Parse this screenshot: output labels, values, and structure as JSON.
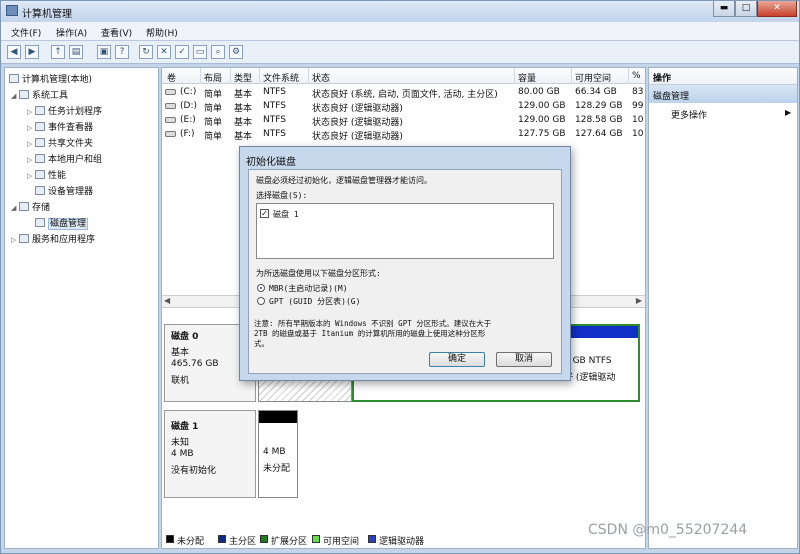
{
  "window": {
    "title": "计算机管理",
    "min": "▬",
    "max": "□",
    "close": "✕"
  },
  "menu": [
    "文件(F)",
    "操作(A)",
    "查看(V)",
    "帮助(H)"
  ],
  "tree": [
    {
      "label": "计算机管理(本地)",
      "icon": "computer-icon"
    },
    {
      "label": "系统工具",
      "icon": "tools-icon"
    },
    {
      "label": "任务计划程序",
      "icon": "clock-icon"
    },
    {
      "label": "事件查看器",
      "icon": "event-icon"
    },
    {
      "label": "共享文件夹",
      "icon": "folder-icon"
    },
    {
      "label": "本地用户和组",
      "icon": "users-icon"
    },
    {
      "label": "性能",
      "icon": "performance-icon"
    },
    {
      "label": "设备管理器",
      "icon": "device-icon"
    },
    {
      "label": "存储",
      "icon": "storage-icon"
    },
    {
      "label": "磁盘管理",
      "icon": "disk-icon"
    },
    {
      "label": "服务和应用程序",
      "icon": "services-icon"
    }
  ],
  "volume_table": {
    "headers": [
      "卷",
      "布局",
      "类型",
      "文件系统",
      "状态",
      "容量",
      "可用空间",
      "%"
    ],
    "rows": [
      [
        "(C:)",
        "简单",
        "基本",
        "NTFS",
        "状态良好 (系统, 启动, 页面文件, 活动, 主分区)",
        "80.00 GB",
        "66.34 GB",
        "83"
      ],
      [
        "(D:)",
        "简单",
        "基本",
        "NTFS",
        "状态良好 (逻辑驱动器)",
        "129.00 GB",
        "128.29 GB",
        "99"
      ],
      [
        "(E:)",
        "简单",
        "基本",
        "NTFS",
        "状态良好 (逻辑驱动器)",
        "129.00 GB",
        "128.58 GB",
        "10"
      ],
      [
        "(F:)",
        "简单",
        "基本",
        "NTFS",
        "状态良好 (逻辑驱动器)",
        "127.75 GB",
        "127.64 GB",
        "10"
      ]
    ]
  },
  "disk0": {
    "name": "磁盘 0",
    "type": "基本",
    "size": "465.76 GB",
    "status": "联机",
    "part_size": "5 GB NTFS",
    "part_status": "好 (逻辑驱动"
  },
  "disk1": {
    "name": "磁盘 1",
    "type": "未知",
    "size": "4 MB",
    "status": "没有初始化",
    "part_size": "4 MB",
    "part_status": "未分配"
  },
  "legend": [
    {
      "label": "未分配",
      "color": "#000000"
    },
    {
      "label": "主分区",
      "color": "#0b2a8c"
    },
    {
      "label": "扩展分区",
      "color": "#1f7a1f"
    },
    {
      "label": "可用空间",
      "color": "#66dd44"
    },
    {
      "label": "逻辑驱动器",
      "color": "#2a3fbf"
    }
  ],
  "actions": {
    "header": "操作",
    "section": "磁盘管理",
    "more": "更多操作",
    "arrow": "▶"
  },
  "dialog": {
    "title": "初始化磁盘",
    "intro": "磁盘必须经过初始化，逻辑磁盘管理器才能访问。",
    "select_label": "选择磁盘(S):",
    "disk_item": "磁盘 1",
    "style_label": "为所选磁盘使用以下磁盘分区形式:",
    "mbr": "MBR(主启动记录)(M)",
    "gpt": "GPT (GUID 分区表)(G)",
    "note1": "注意: 所有早期版本的 Windows 不识别 GPT 分区形式。建议在大于",
    "note2": "2TB 的磁盘或基于 Itanium 的计算机所用的磁盘上使用这种分区形",
    "note3": "式。",
    "ok": "确定",
    "cancel": "取消"
  },
  "watermark": "CSDN @m0_55207244"
}
